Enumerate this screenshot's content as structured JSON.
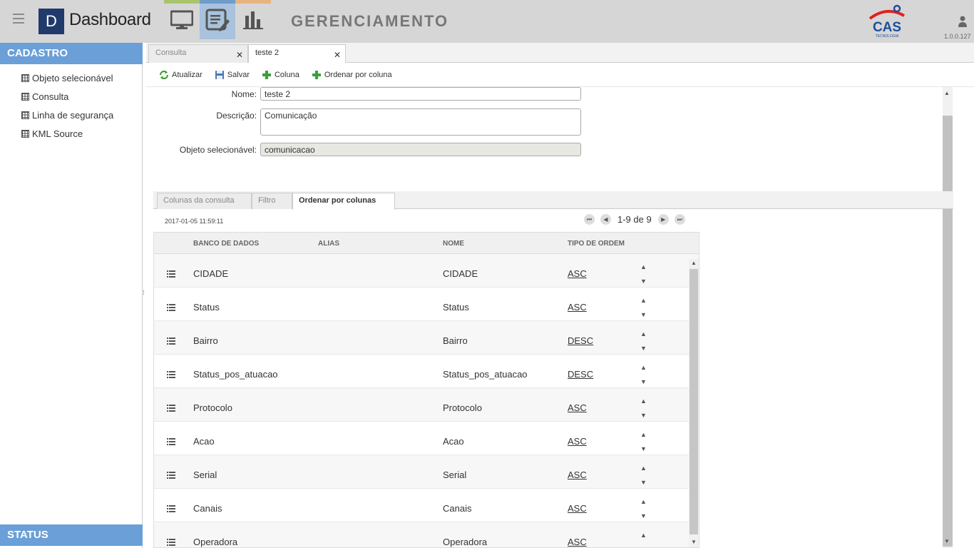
{
  "header": {
    "brand_letter": "D",
    "brand": "Dashboard",
    "title": "GERENCIAMENTO",
    "cas_text": "CAS",
    "cas_sub": "TECNOLOGIA",
    "version": "1.0.0.127"
  },
  "sidebar": {
    "section_title": "CADASTRO",
    "items": [
      {
        "label": "Objeto selecionável"
      },
      {
        "label": "Consulta"
      },
      {
        "label": "Linha de segurança"
      },
      {
        "label": "KML Source"
      }
    ],
    "footer_title": "STATUS"
  },
  "tabs": [
    {
      "label": "Consulta"
    },
    {
      "label": "teste 2"
    }
  ],
  "toolbar": {
    "refresh": "Atualizar",
    "save": "Salvar",
    "add_column": "Coluna",
    "order_by_column": "Ordenar por coluna"
  },
  "form": {
    "name_label": "Nome:",
    "name_value": "teste 2",
    "description_label": "Descrição:",
    "description_value": "Comunicação",
    "object_label": "Objeto selecionável:",
    "object_value": "comunicacao"
  },
  "inner_tabs": [
    {
      "label": "Colunas da consulta"
    },
    {
      "label": "Filtro"
    },
    {
      "label": "Ordenar por colunas"
    }
  ],
  "grid": {
    "timestamp": "2017-01-05 11:59:11",
    "pager": "1-9 de 9",
    "columns": [
      "BANCO DE DADOS",
      "ALIAS",
      "NOME",
      "TIPO DE ORDEM"
    ],
    "rows": [
      {
        "banco": "CIDADE",
        "alias": "",
        "nome": "CIDADE",
        "ordem": "ASC"
      },
      {
        "banco": "Status",
        "alias": "",
        "nome": "Status",
        "ordem": "ASC"
      },
      {
        "banco": "Bairro",
        "alias": "",
        "nome": "Bairro",
        "ordem": "DESC"
      },
      {
        "banco": "Status_pos_atuacao",
        "alias": "",
        "nome": "Status_pos_atuacao",
        "ordem": "DESC"
      },
      {
        "banco": "Protocolo",
        "alias": "",
        "nome": "Protocolo",
        "ordem": "ASC"
      },
      {
        "banco": "Acao",
        "alias": "",
        "nome": "Acao",
        "ordem": "ASC"
      },
      {
        "banco": "Serial",
        "alias": "",
        "nome": "Serial",
        "ordem": "ASC"
      },
      {
        "banco": "Canais",
        "alias": "",
        "nome": "Canais",
        "ordem": "ASC"
      },
      {
        "banco": "Operadora",
        "alias": "",
        "nome": "Operadora",
        "ordem": "ASC"
      }
    ]
  }
}
